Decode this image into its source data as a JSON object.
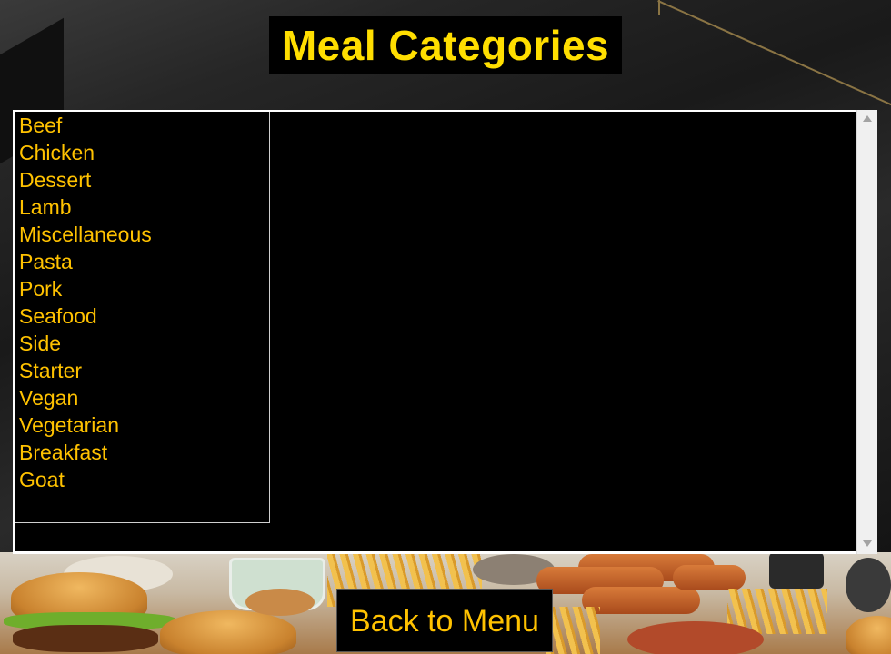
{
  "header": {
    "title": "Meal Categories"
  },
  "categories": {
    "items": [
      "Beef",
      "Chicken",
      "Dessert",
      "Lamb",
      "Miscellaneous",
      "Pasta",
      "Pork",
      "Seafood",
      "Side",
      "Starter",
      "Vegan",
      "Vegetarian",
      "Breakfast",
      "Goat"
    ]
  },
  "footer": {
    "back_label": "Back to Menu"
  },
  "colors": {
    "accent_text": "#ffc200",
    "title_text": "#ffde00",
    "panel_bg": "#000000"
  }
}
